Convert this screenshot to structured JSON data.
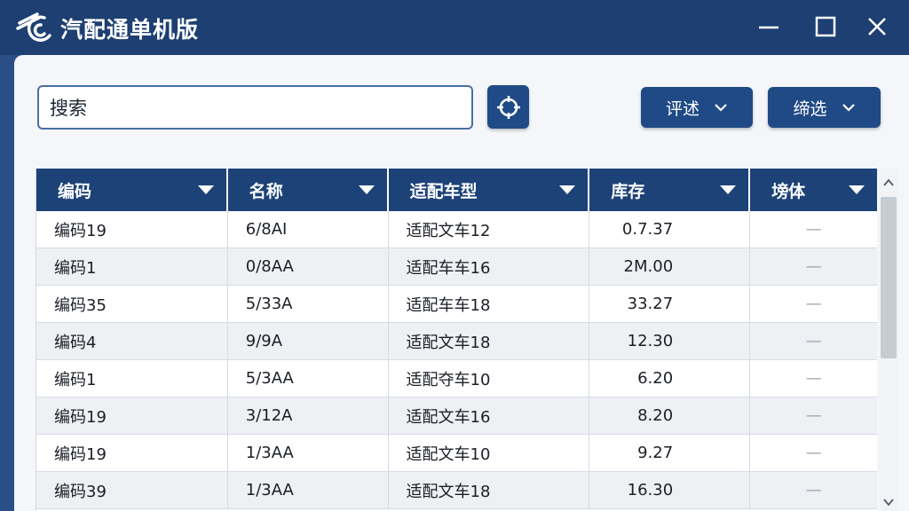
{
  "window": {
    "title": "汽配通单机版",
    "icons": {
      "logo": "car-parts-logo-icon",
      "minimize": "minimize-icon",
      "maximize": "maximize-icon",
      "close": "close-icon"
    }
  },
  "toolbar": {
    "search_value": "搜索",
    "scan_icon": "crosshair-icon",
    "review_label": "评述",
    "filter_label": "缔选"
  },
  "table": {
    "columns": [
      "编码",
      "名称",
      "适配车型",
      "库存",
      "塝体"
    ],
    "rows": [
      {
        "code": "编码19",
        "name": "6/8AI",
        "model": "适配文车12",
        "stock": "0.7.37",
        "extra": "—"
      },
      {
        "code": "编码1",
        "name": "0/8AA",
        "model": "适配车车16",
        "stock": "2M.00",
        "extra": "—"
      },
      {
        "code": "编码35",
        "name": "5/33A",
        "model": "适配车车18",
        "stock": "33.27",
        "extra": "—"
      },
      {
        "code": "编码4",
        "name": "9/9A",
        "model": "适配文车18",
        "stock": "12.30",
        "extra": "—"
      },
      {
        "code": "编码1",
        "name": "5/3AA",
        "model": "适配夺车10",
        "stock": "6.20",
        "extra": "—"
      },
      {
        "code": "编码19",
        "name": "3/12A",
        "model": "适配文车16",
        "stock": "8.20",
        "extra": "—"
      },
      {
        "code": "编码19",
        "name": "1/3AA",
        "model": "适配文车10",
        "stock": "9.27",
        "extra": "—"
      },
      {
        "code": "编码39",
        "name": "1/3AA",
        "model": "适配文车18",
        "stock": "16.30",
        "extra": "—"
      }
    ]
  },
  "colors": {
    "titlebar": "#1d3f72",
    "accent": "#1f4a86",
    "header": "#1d4278"
  }
}
